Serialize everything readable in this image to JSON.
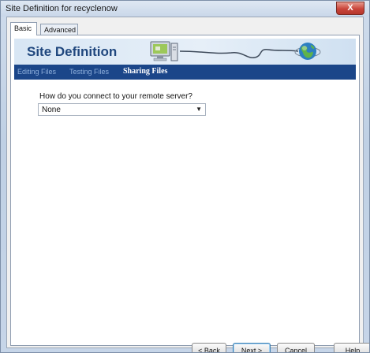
{
  "window": {
    "title": "Site Definition for recyclenow",
    "close_label": "X"
  },
  "tabs": [
    {
      "label": "Basic",
      "active": true
    },
    {
      "label": "Advanced",
      "active": false
    }
  ],
  "banner": {
    "title": "Site Definition",
    "icons": [
      "computer-icon",
      "cable-icon",
      "globe-icon"
    ]
  },
  "steps": [
    {
      "label": "Editing Files",
      "current": false
    },
    {
      "label": "Testing Files",
      "current": false
    },
    {
      "label": "Sharing Files",
      "current": true
    }
  ],
  "form": {
    "question": "How do you connect to your remote server?",
    "connection": {
      "value": "None"
    }
  },
  "buttons": {
    "back": "< Back",
    "next": "Next >",
    "cancel": "Cancel",
    "help": "Help"
  },
  "colors": {
    "steps_bar": "#1b4689",
    "banner_title": "#20477e",
    "close_button": "#c9453a"
  }
}
